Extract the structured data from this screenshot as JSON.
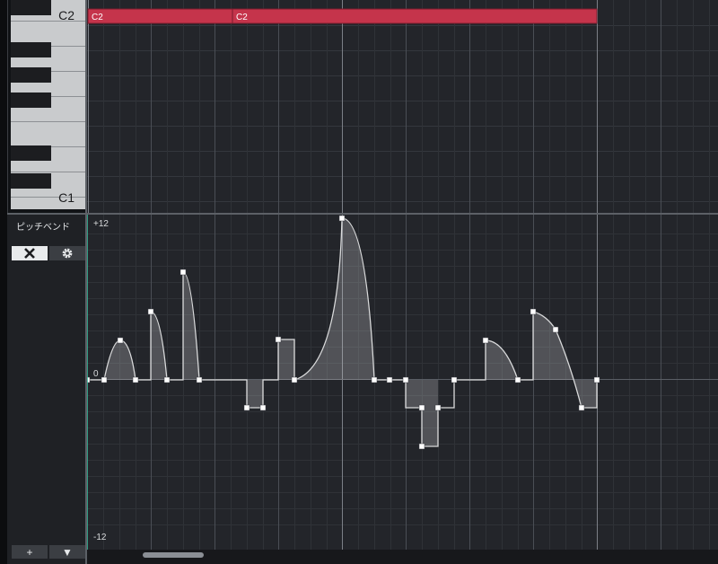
{
  "keyboard": {
    "upper_note": "C2",
    "lower_note": "C1"
  },
  "note_events": [
    {
      "label": "C2"
    },
    {
      "label": "C2"
    }
  ],
  "lane": {
    "name": "ピッチベンド",
    "mute_icon": "x-mark-icon",
    "settings_icon": "gear-icon",
    "add_button": "+",
    "menu_button": "▼"
  },
  "pitchbend_axis": {
    "max": "+12",
    "zero": "0",
    "min": "-12"
  },
  "colors": {
    "note_event": "#c5344b",
    "background": "#23252a",
    "curve": "#d9dadb",
    "cursor": "#33b99a"
  }
}
